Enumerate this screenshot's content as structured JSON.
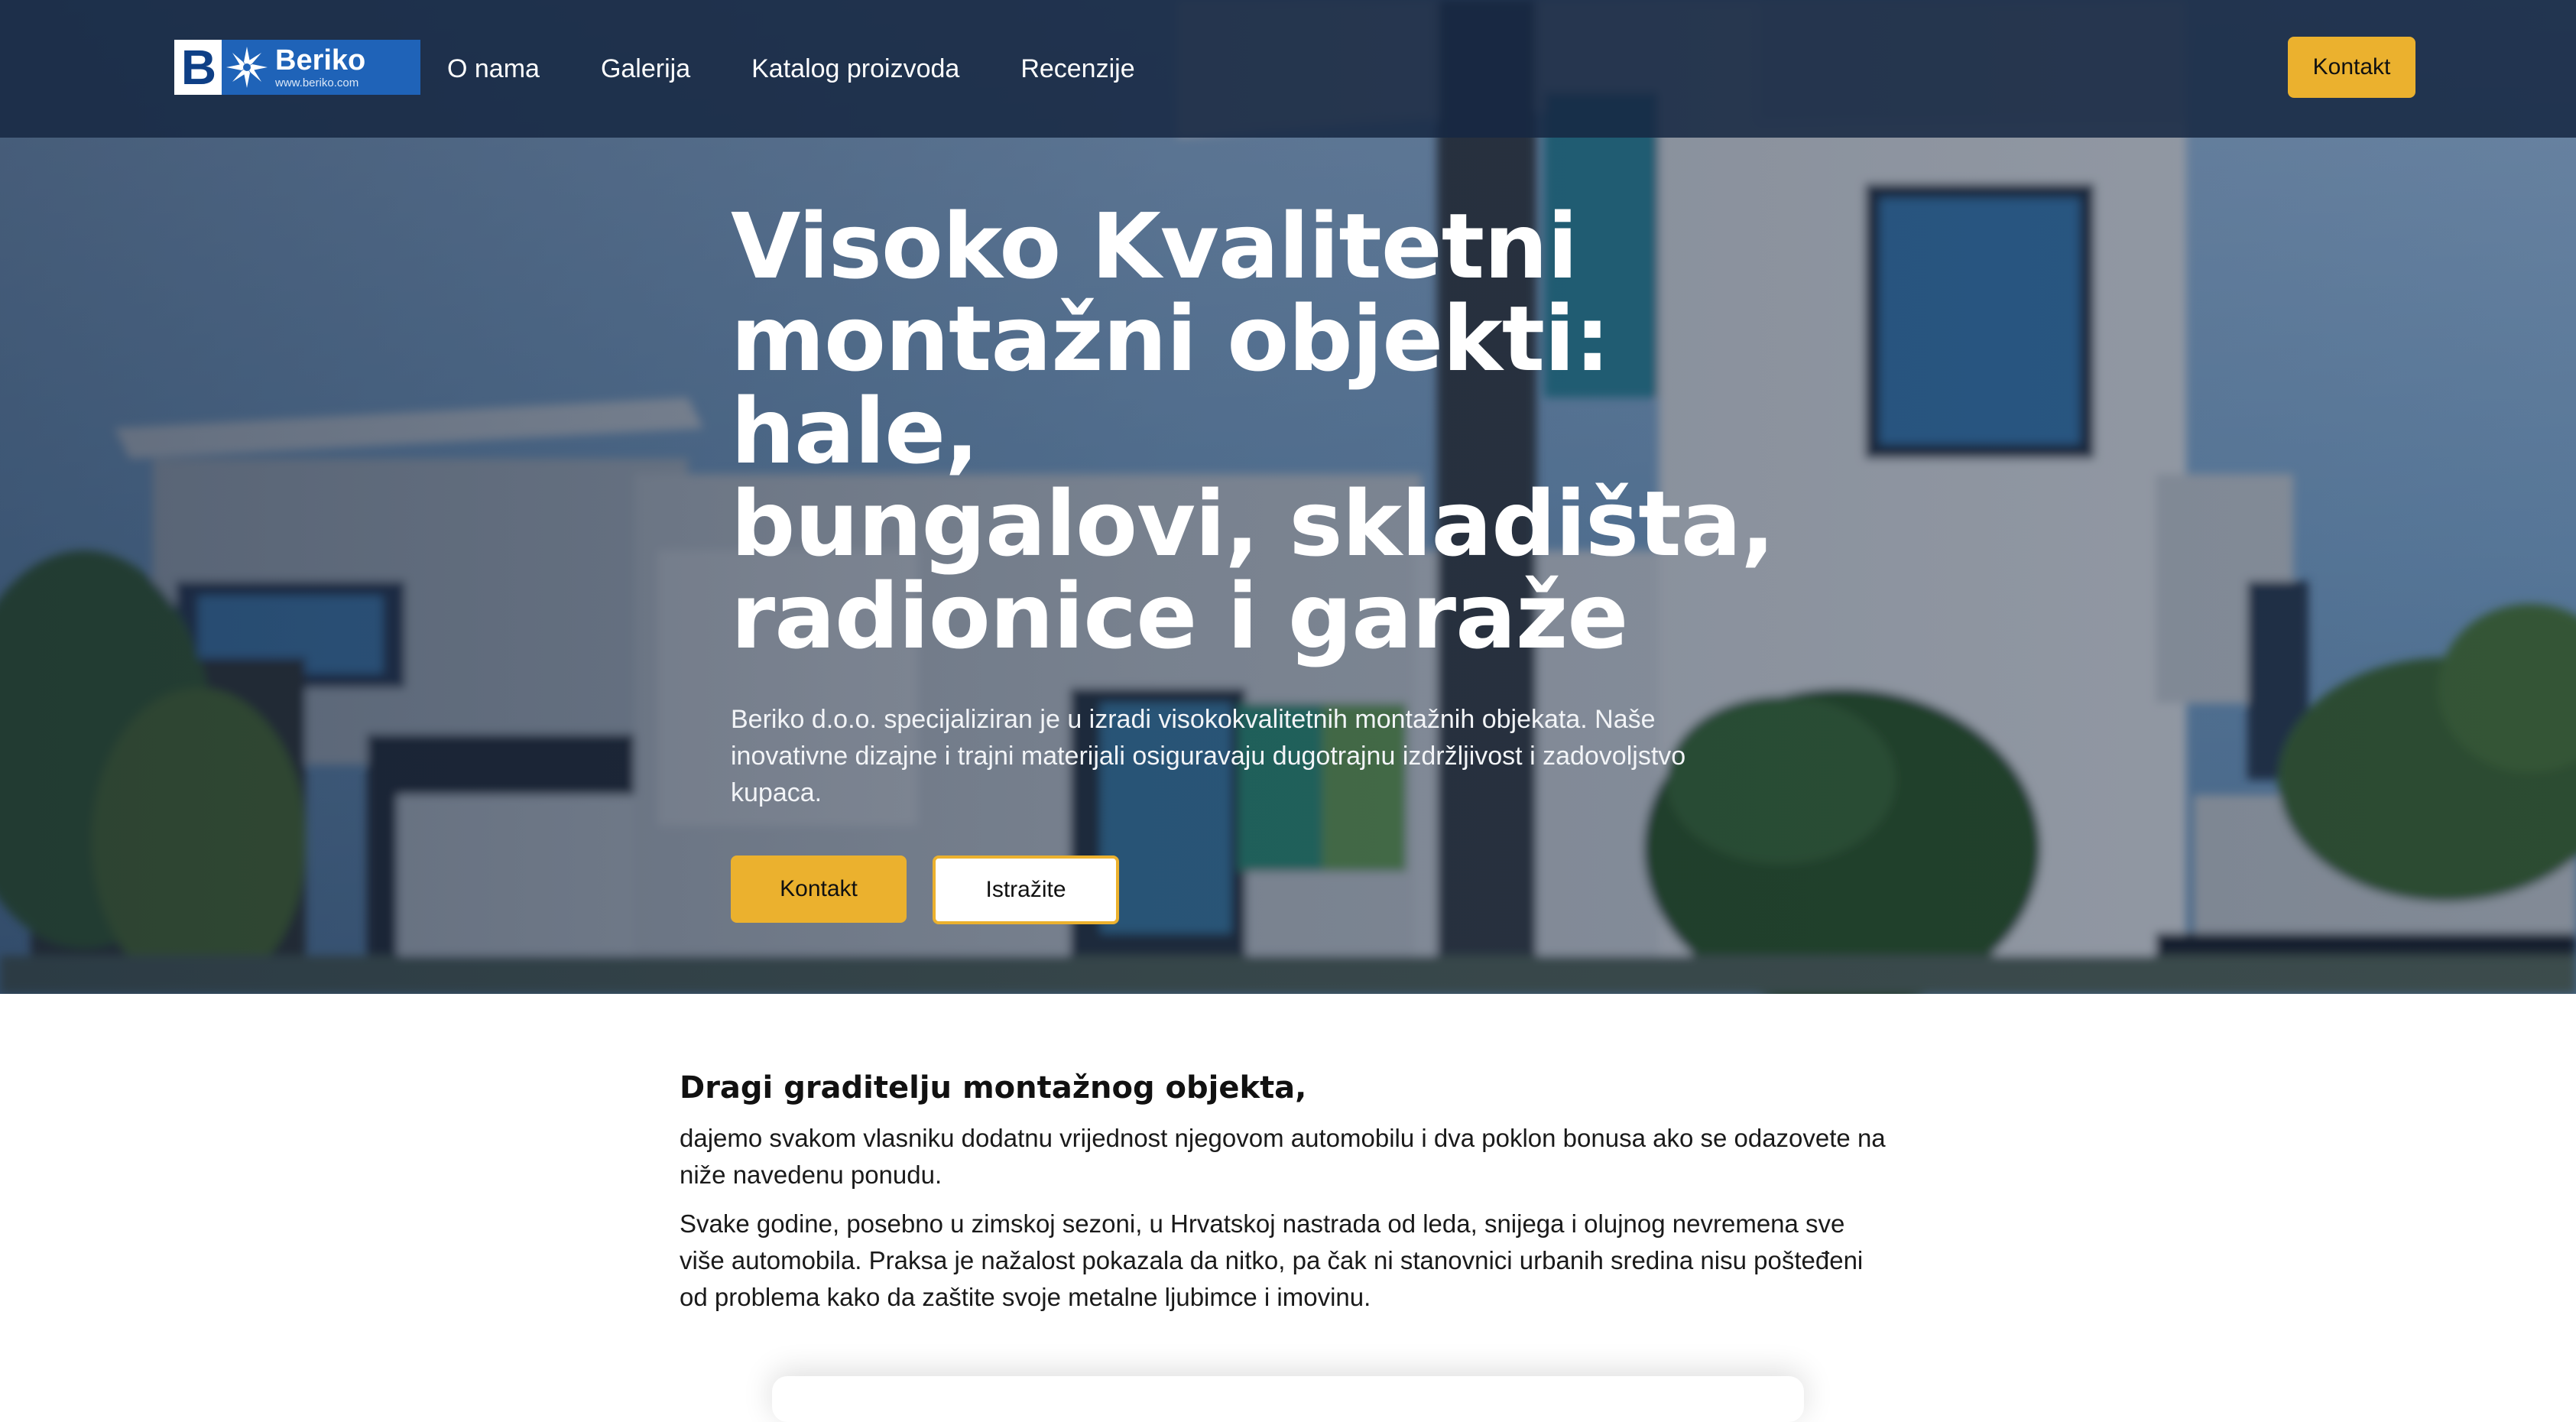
{
  "brand": {
    "logo_letter": "B",
    "name": "Beriko",
    "url": "www.beriko.com"
  },
  "nav": {
    "items": [
      "O nama",
      "Galerija",
      "Katalog proizvoda",
      "Recenzije"
    ],
    "cta_label": "Kontakt"
  },
  "hero": {
    "title_lines": [
      "Visoko Kvalitetni",
      "montažni objekti: hale,",
      "bungalovi, skladišta,",
      "radionice i garaže"
    ],
    "subtitle": "Beriko d.o.o. specijaliziran je u izradi visokokvalitetnih montažnih objekata. Naše inovativne dizajne i trajni materijali osiguravaju dugotrajnu izdržljivost i zadovoljstvo kupaca.",
    "primary_button": "Kontakt",
    "secondary_button": "Istražite"
  },
  "intro": {
    "heading": "Dragi graditelju montažnog objekta,",
    "paragraphs": [
      "dajemo svakom vlasniku dodatnu vrijednost njegovom automobilu i dva poklon bonusa ako se odazovete na niže navedenu ponudu.",
      "Svake godine, posebno u zimskoj sezoni, u Hrvatskoj nastrada od leda, snijega i olujnog nevremena sve više automobila. Praksa je nažalost pokazala da nitko, pa čak ni stanovnici urbanih sredina nisu pošteđeni od problema kako da zaštite svoje metalne ljubimce i imovinu."
    ]
  },
  "colors": {
    "accent": "#ebb12e",
    "nav_bg": "#162842",
    "logo_blue": "#1f63b8"
  }
}
